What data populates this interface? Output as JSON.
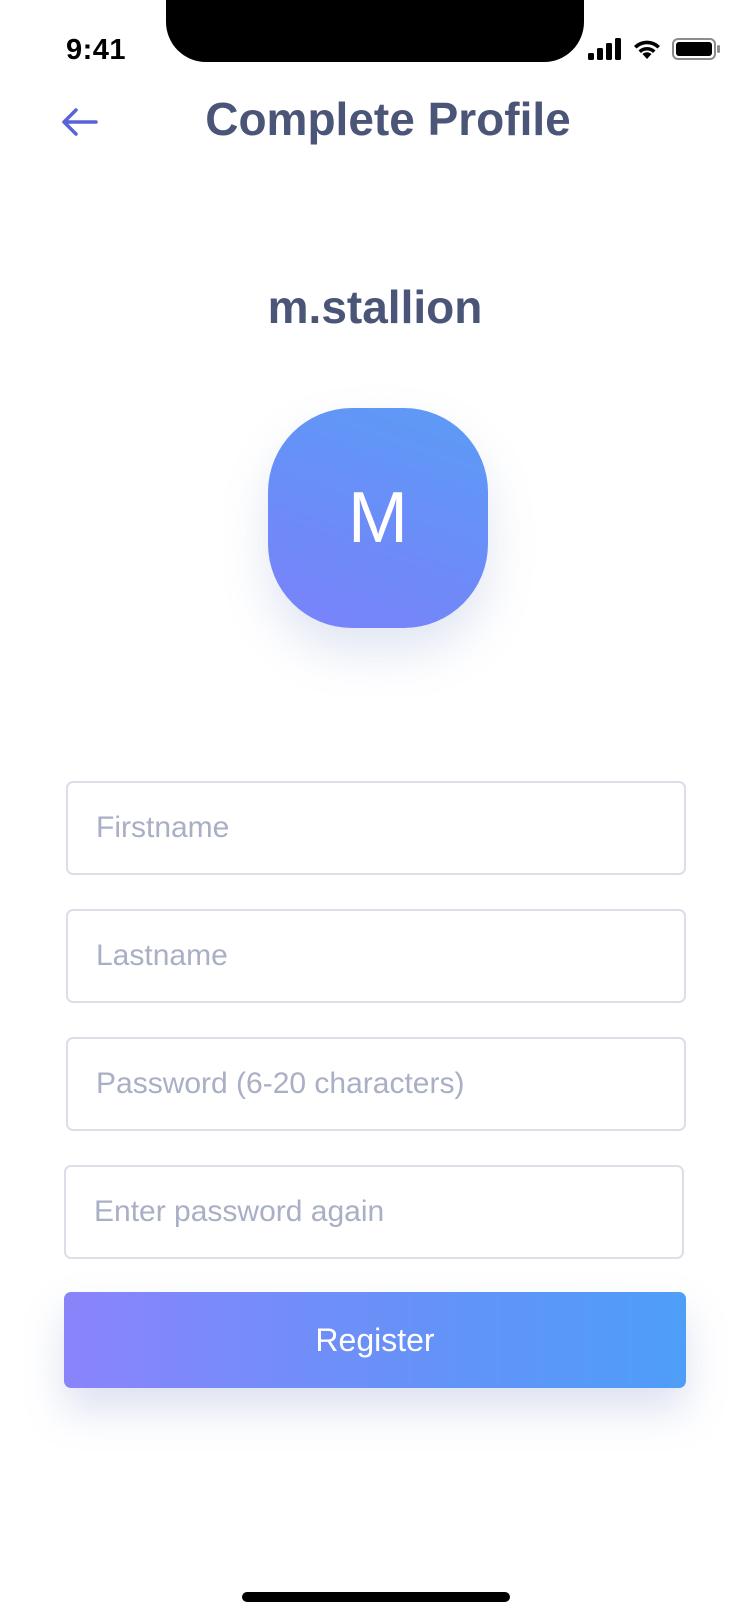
{
  "status_bar": {
    "time": "9:41",
    "icons": [
      "cellular-signal-icon",
      "wifi-icon",
      "battery-icon"
    ]
  },
  "header": {
    "back_icon": "arrow-left-icon",
    "title": "Complete Profile"
  },
  "profile": {
    "username": "m.stallion",
    "avatar_initial": "M"
  },
  "form": {
    "firstname_placeholder": "Firstname",
    "lastname_placeholder": "Lastname",
    "password_placeholder": "Password (6-20 characters)",
    "password_again_placeholder": "Enter password again"
  },
  "actions": {
    "register_label": "Register"
  },
  "colors": {
    "title_text": "#4a5578",
    "accent_back_arrow": "#5a62d8",
    "placeholder_text": "#a9afc4",
    "field_border": "#dcdfe8",
    "gradient_start": "#8a84fa",
    "gradient_end": "#4e9ef8"
  }
}
